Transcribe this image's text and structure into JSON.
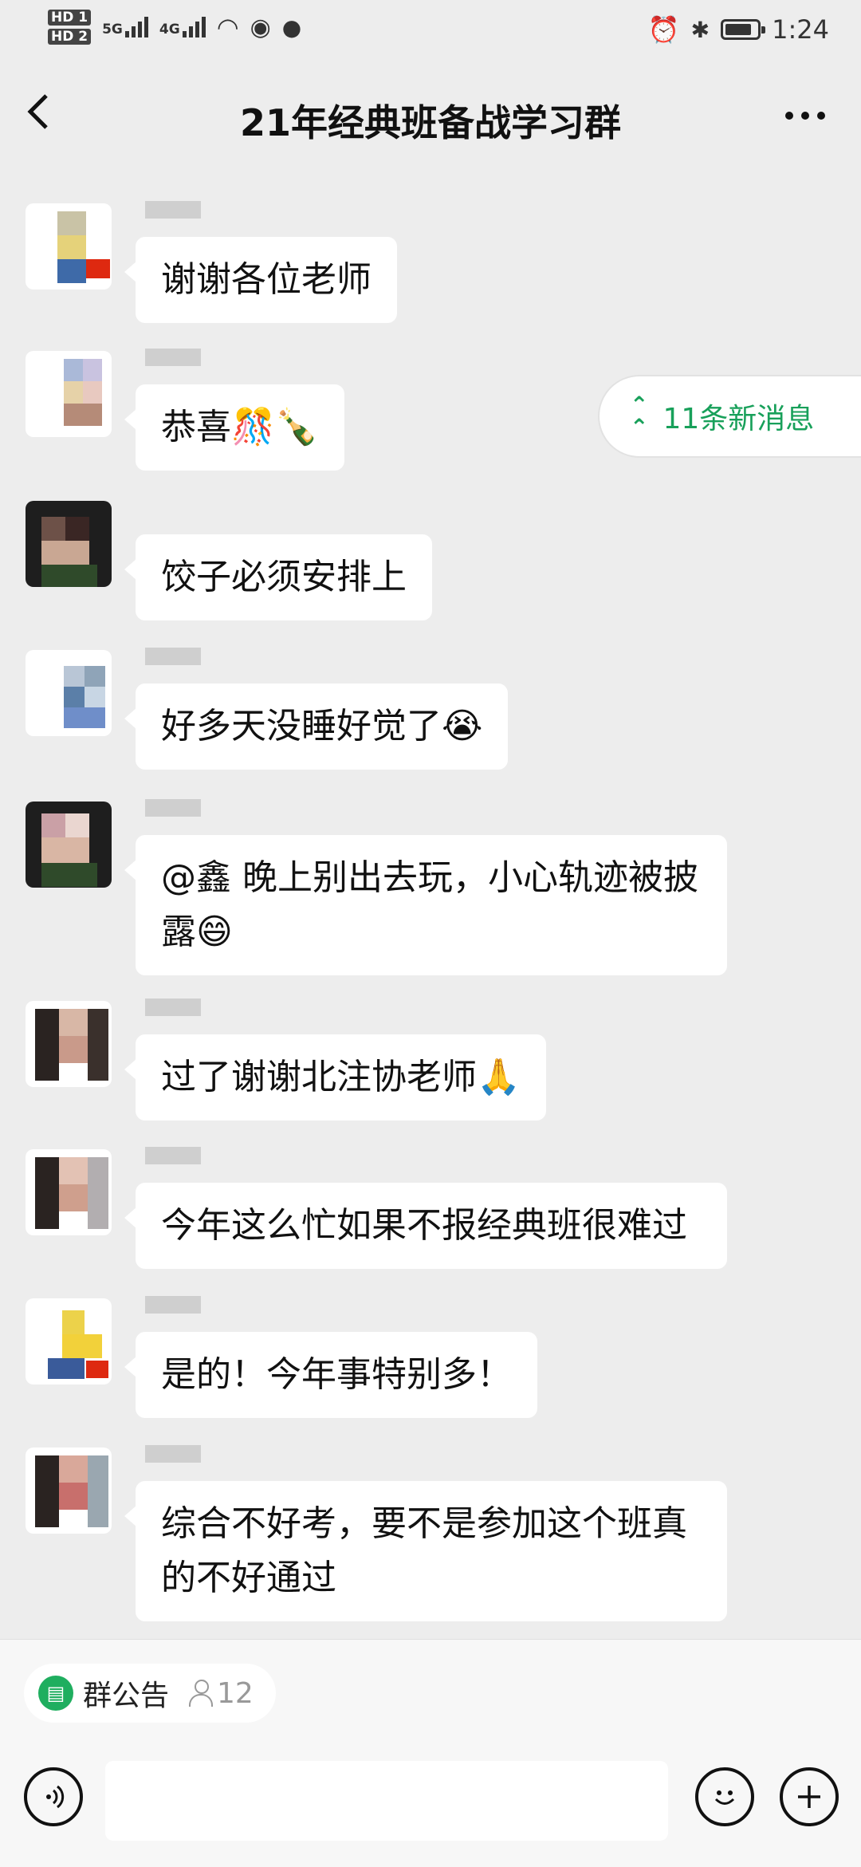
{
  "status_bar": {
    "hd1": "HD 1",
    "hd2": "HD 2",
    "net5g": "5G",
    "net4g": "4G",
    "battery_level": 85,
    "time": "1:24"
  },
  "nav": {
    "back_icon": "chevron-left-icon",
    "title": "21年经典班备战学习群",
    "more_icon": "more-dots-icon"
  },
  "new_messages": {
    "icon": "double-chevron-up-icon",
    "label": "11条新消息"
  },
  "messages": [
    {
      "sender": "",
      "text": "谢谢各位老师"
    },
    {
      "sender": "",
      "text": "恭喜🎊🍾"
    },
    {
      "sender": "",
      "text": "饺子必须安排上"
    },
    {
      "sender": "",
      "text": "好多天没睡好觉了😭"
    },
    {
      "sender": "",
      "text": "@鑫 晚上别出去玩，小心轨迹被披露😄"
    },
    {
      "sender": "",
      "text": "过了谢谢北注协老师🙏"
    },
    {
      "sender": "",
      "text": "今年这么忙如果不报经典班很难过"
    },
    {
      "sender": "",
      "text": "是的！今年事特别多！"
    },
    {
      "sender": "",
      "text": "综合不好考，要不是参加这个班真的不好通过"
    }
  ],
  "bottom": {
    "notice_label": "群公告",
    "member_count": "12",
    "input_placeholder": "",
    "voice_icon": "voice-icon",
    "emoji_icon": "smiley-icon",
    "plus_icon": "plus-icon"
  }
}
